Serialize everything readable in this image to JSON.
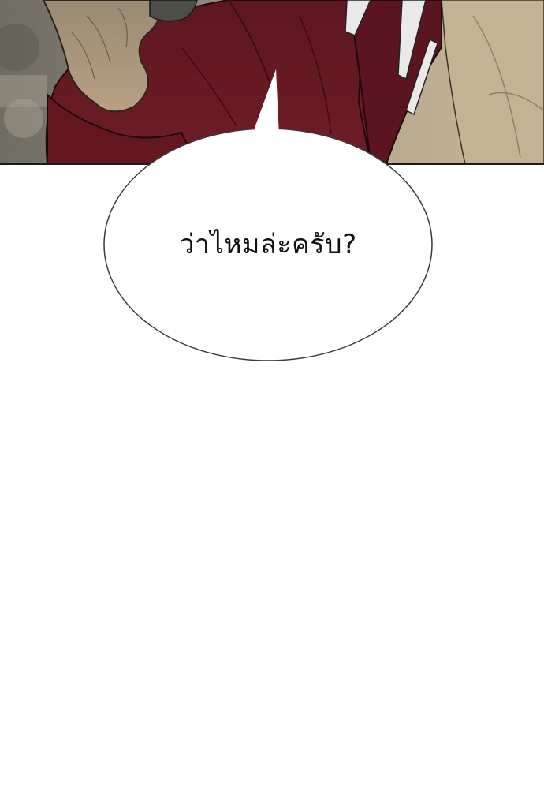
{
  "speech_bubble": {
    "text": "ว่าไหมล่ะครับ?"
  },
  "colors": {
    "page_background": "#ffffff",
    "jacket": "#6b1a22",
    "skin": "#b79a7e",
    "background_beige": "#c9b79c",
    "bubble_outline": "#3a3a3a",
    "panel_border": "#1a1a1a"
  }
}
